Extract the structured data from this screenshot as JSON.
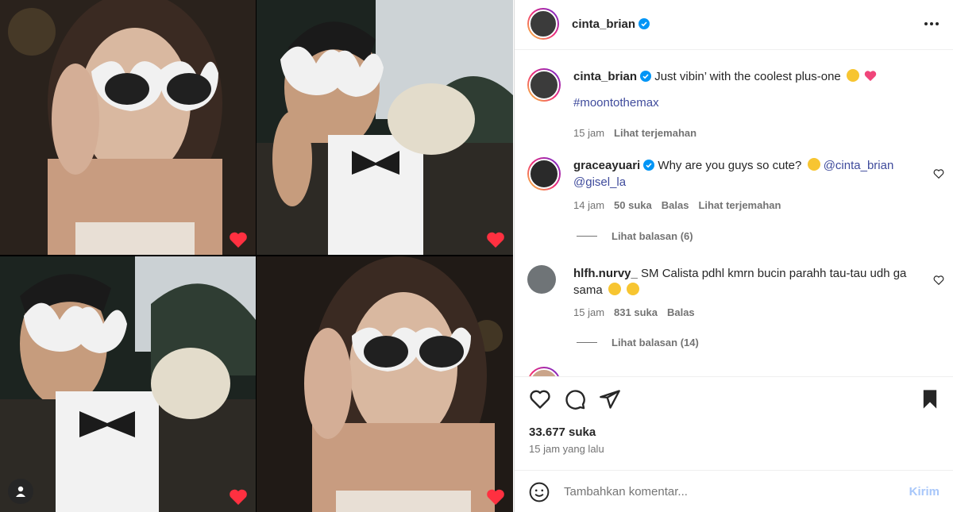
{
  "post": {
    "author": "cinta_brian",
    "more_icon": "more-horizontal-icon"
  },
  "caption": {
    "author": "cinta_brian",
    "text": "Just vibin’ with the coolest plus-one",
    "hashtag": "#moontothemax",
    "time": "15 jam",
    "translate": "Lihat terjemahan"
  },
  "comments": [
    {
      "author": "graceayuari",
      "text": "Why are you guys so cute?",
      "mention1": "@cinta_brian",
      "mention2": "@gisel_la",
      "time": "14 jam",
      "likes": "50 suka",
      "reply": "Balas",
      "translate": "Lihat terjemahan",
      "view_replies": "Lihat balasan (6)"
    },
    {
      "author": "hlfh.nurvy_",
      "text": "SM Calista pdhl kmrn bucin parahh tau-tau udh ga sama",
      "time": "15 jam",
      "likes": "831 suka",
      "reply": "Balas",
      "view_replies": "Lihat balasan (14)"
    }
  ],
  "stats": {
    "likes": "33.677 suka",
    "posted": "15 jam yang lalu"
  },
  "composer": {
    "placeholder": "Tambahkan komentar...",
    "send": "Kirim"
  },
  "colors": {
    "verified": "#0095f6",
    "link": "#3f4b9c",
    "like_red": "#ff3040",
    "send_disabled": "#a8c7fa"
  }
}
